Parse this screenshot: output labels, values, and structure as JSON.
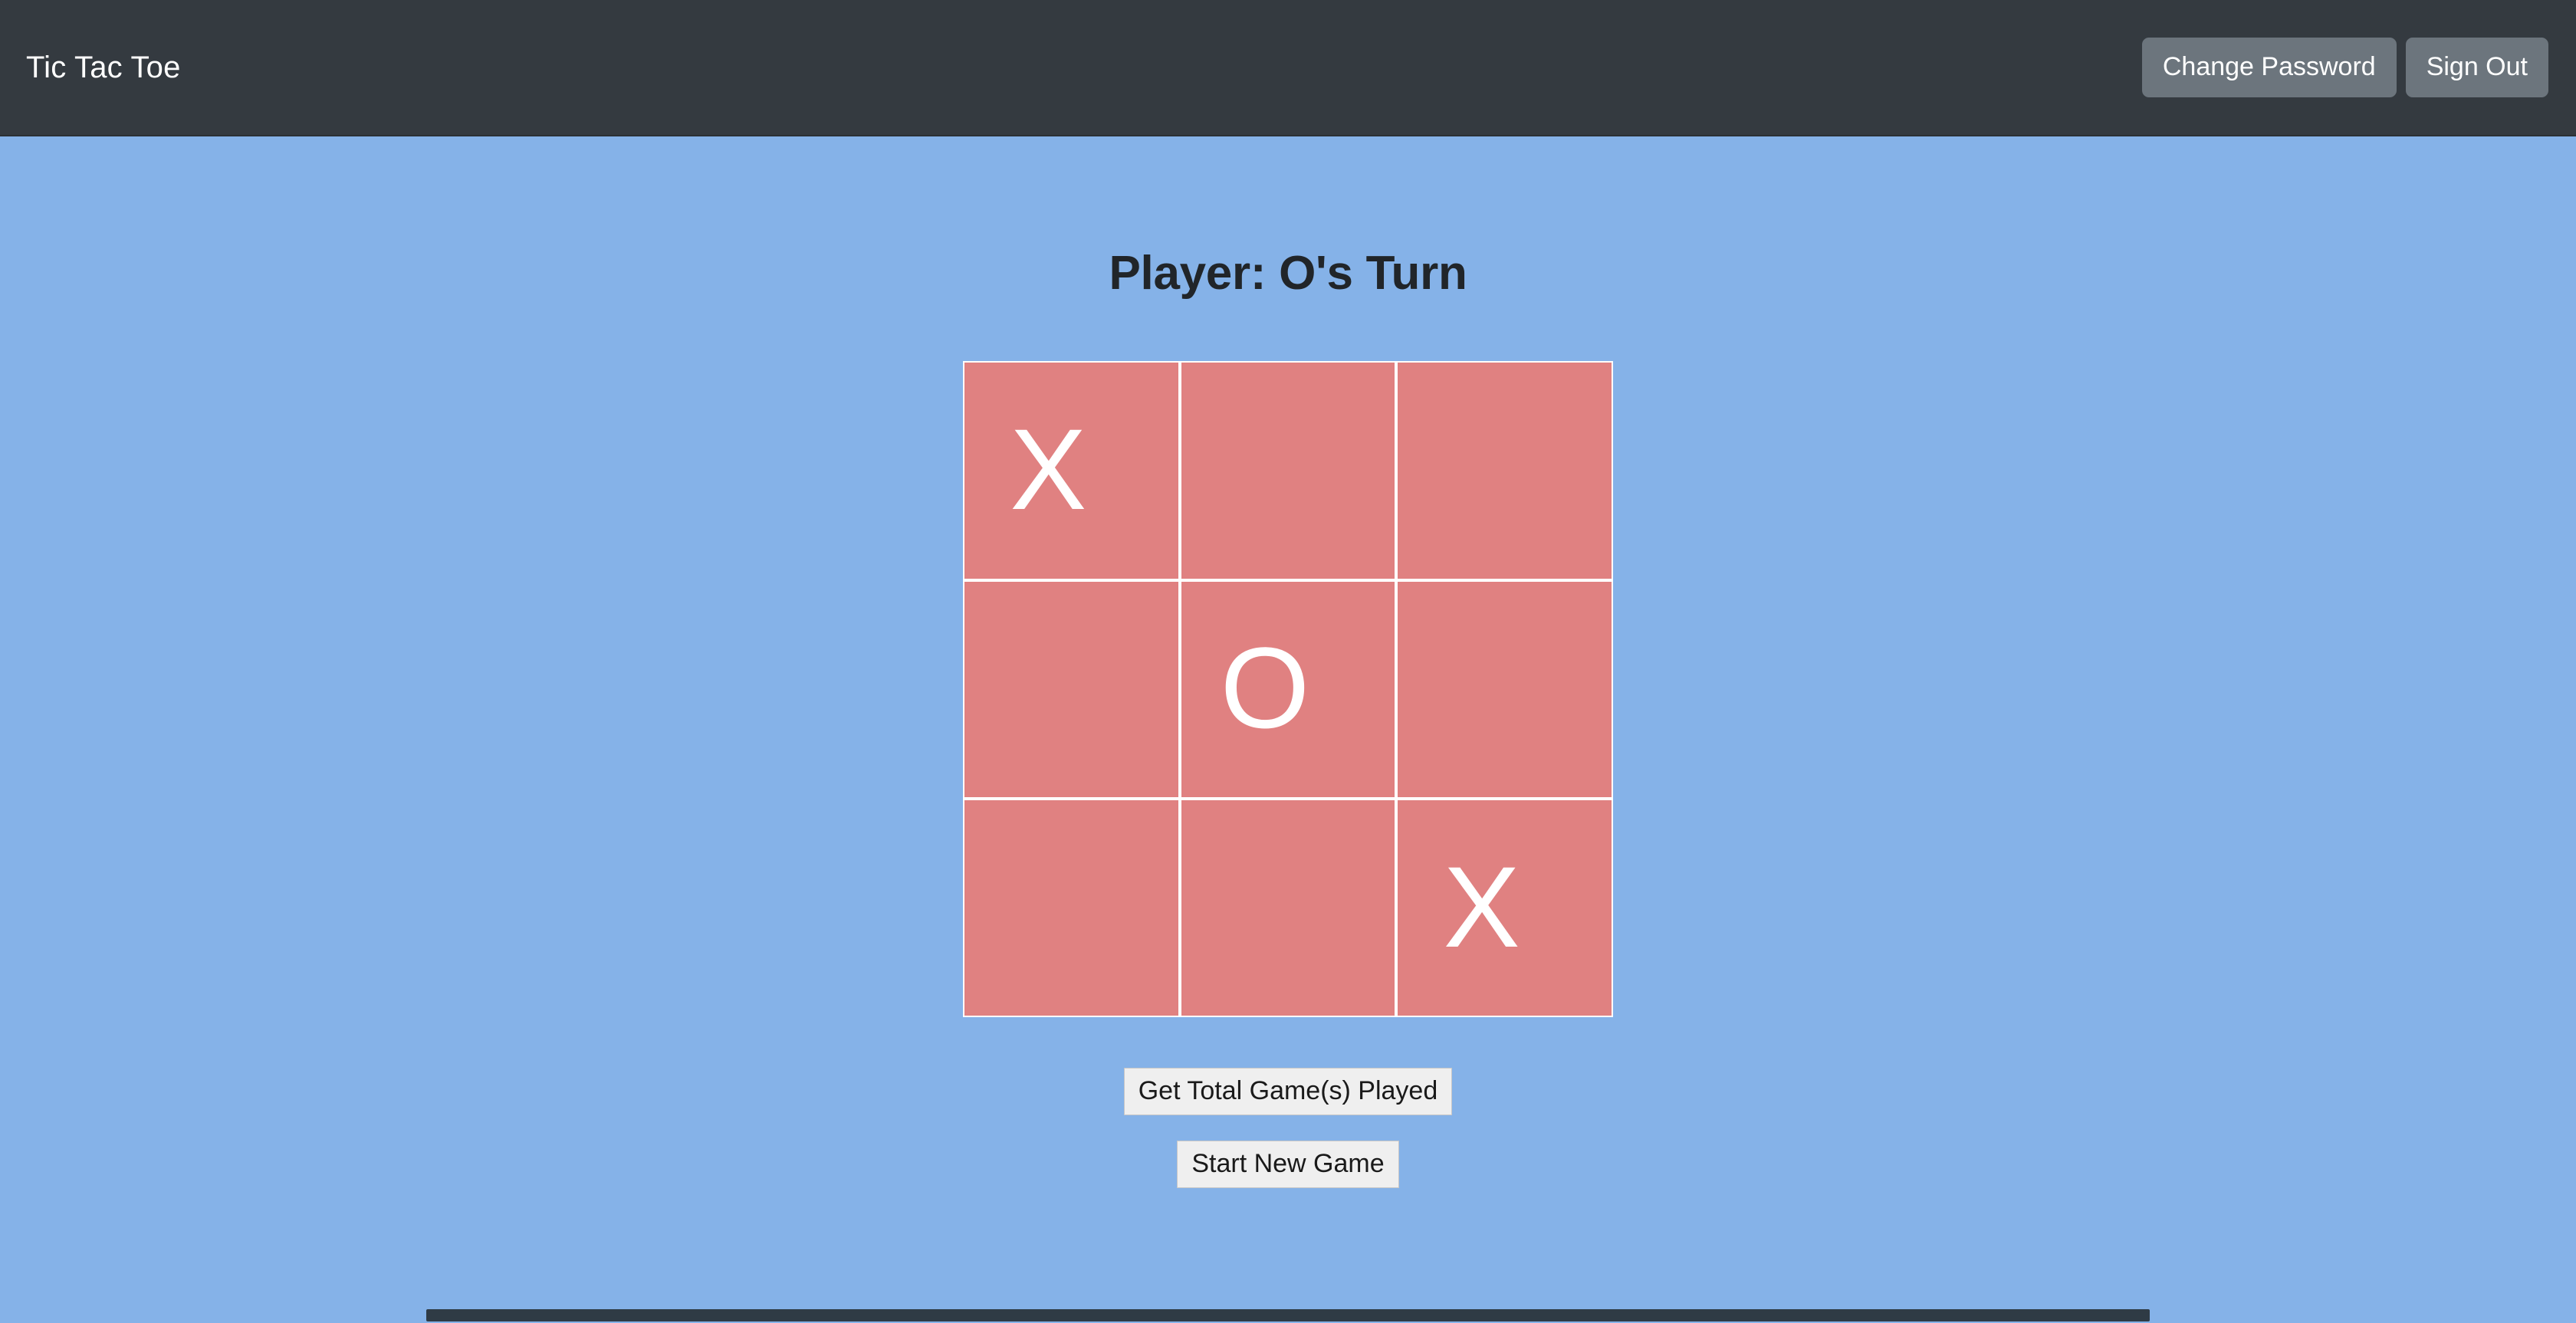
{
  "navbar": {
    "brand": "Tic Tac Toe",
    "buttons": [
      {
        "label": "Change Password"
      },
      {
        "label": "Sign Out"
      }
    ],
    "background_color": "#343A40",
    "button_color": "#6C757D",
    "brand_color": "#FFFFFF"
  },
  "page": {
    "background_color": "#85B2E8",
    "status": "Player: O's Turn"
  },
  "board": {
    "cell_color": "#E08181",
    "grid_line_color": "#FFFFFF",
    "mark_color": "#FFFFFF",
    "cells": [
      {
        "index": 0,
        "position": "top-left",
        "mark": "X"
      },
      {
        "index": 1,
        "position": "top-center",
        "mark": ""
      },
      {
        "index": 2,
        "position": "top-right",
        "mark": ""
      },
      {
        "index": 3,
        "position": "middle-left",
        "mark": ""
      },
      {
        "index": 4,
        "position": "middle-center",
        "mark": "O"
      },
      {
        "index": 5,
        "position": "middle-right",
        "mark": ""
      },
      {
        "index": 6,
        "position": "bottom-left",
        "mark": ""
      },
      {
        "index": 7,
        "position": "bottom-center",
        "mark": ""
      },
      {
        "index": 8,
        "position": "bottom-right",
        "mark": "X"
      }
    ]
  },
  "actions": {
    "get_total_games": "Get Total Game(s) Played",
    "start_new_game": "Start New Game"
  },
  "scrollbar": {
    "orientation": "horizontal",
    "thumb_color": "#2F3B45"
  }
}
